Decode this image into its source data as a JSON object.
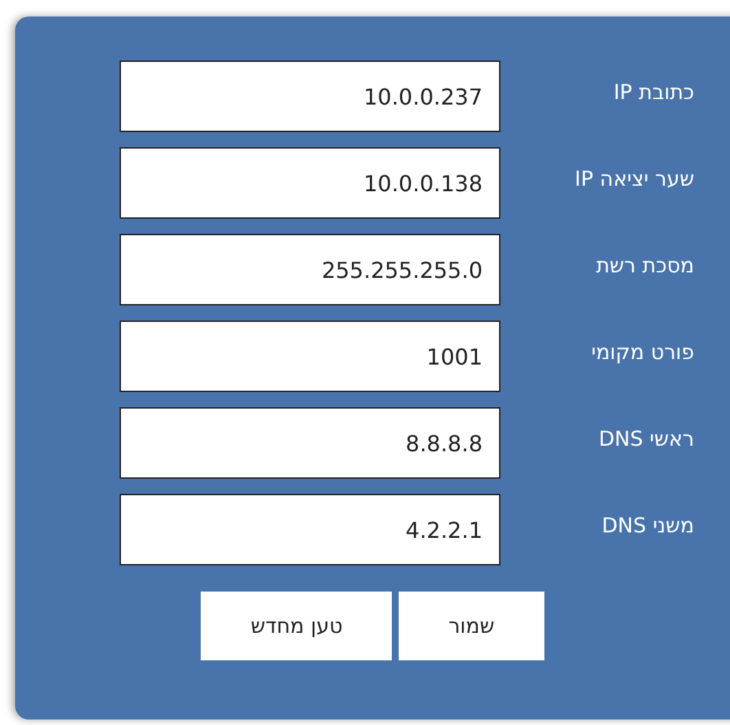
{
  "fields": [
    {
      "label": "כתובת IP",
      "value": "10.0.0.237"
    },
    {
      "label": "שער יציאה IP",
      "value": "10.0.0.138"
    },
    {
      "label": "מסכת רשת",
      "value": "255.255.255.0"
    },
    {
      "label": "פורט מקומי",
      "value": "1001"
    },
    {
      "label": "ראשי DNS",
      "value": "8.8.8.8"
    },
    {
      "label": "משני DNS",
      "value": "4.2.2.1"
    }
  ],
  "buttons": [
    "שמור",
    "טען מחדש"
  ]
}
